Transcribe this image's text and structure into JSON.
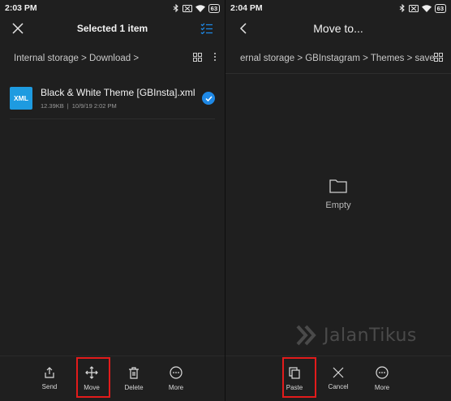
{
  "left": {
    "status": {
      "time": "2:03 PM",
      "battery": "63"
    },
    "header": {
      "title": "Selected 1 item"
    },
    "path": {
      "text": "Internal storage > Download >"
    },
    "file": {
      "icon_label": "XML",
      "name": "Black & White Theme [GBInsta].xml",
      "size": "12.39KB",
      "separator": "|",
      "date": "10/9/19 2:02 PM"
    },
    "bottom": [
      {
        "label": "Send",
        "icon": "share-icon"
      },
      {
        "label": "Move",
        "icon": "move-icon"
      },
      {
        "label": "Delete",
        "icon": "trash-icon"
      },
      {
        "label": "More",
        "icon": "more-icon"
      }
    ]
  },
  "right": {
    "status": {
      "time": "2:04 PM",
      "battery": "63"
    },
    "header": {
      "title": "Move to..."
    },
    "path": {
      "text": "ernal storage > GBInstagram > Themes > saved >"
    },
    "empty": {
      "label": "Empty"
    },
    "bottom": [
      {
        "label": "Paste",
        "icon": "paste-icon"
      },
      {
        "label": "Cancel",
        "icon": "close-icon"
      },
      {
        "label": "More",
        "icon": "more-icon"
      }
    ]
  },
  "watermark": {
    "text": "JalanTikus"
  },
  "colors": {
    "accent": "#1e88e5",
    "highlight": "#e21b1b",
    "background": "#1f1f1f"
  }
}
